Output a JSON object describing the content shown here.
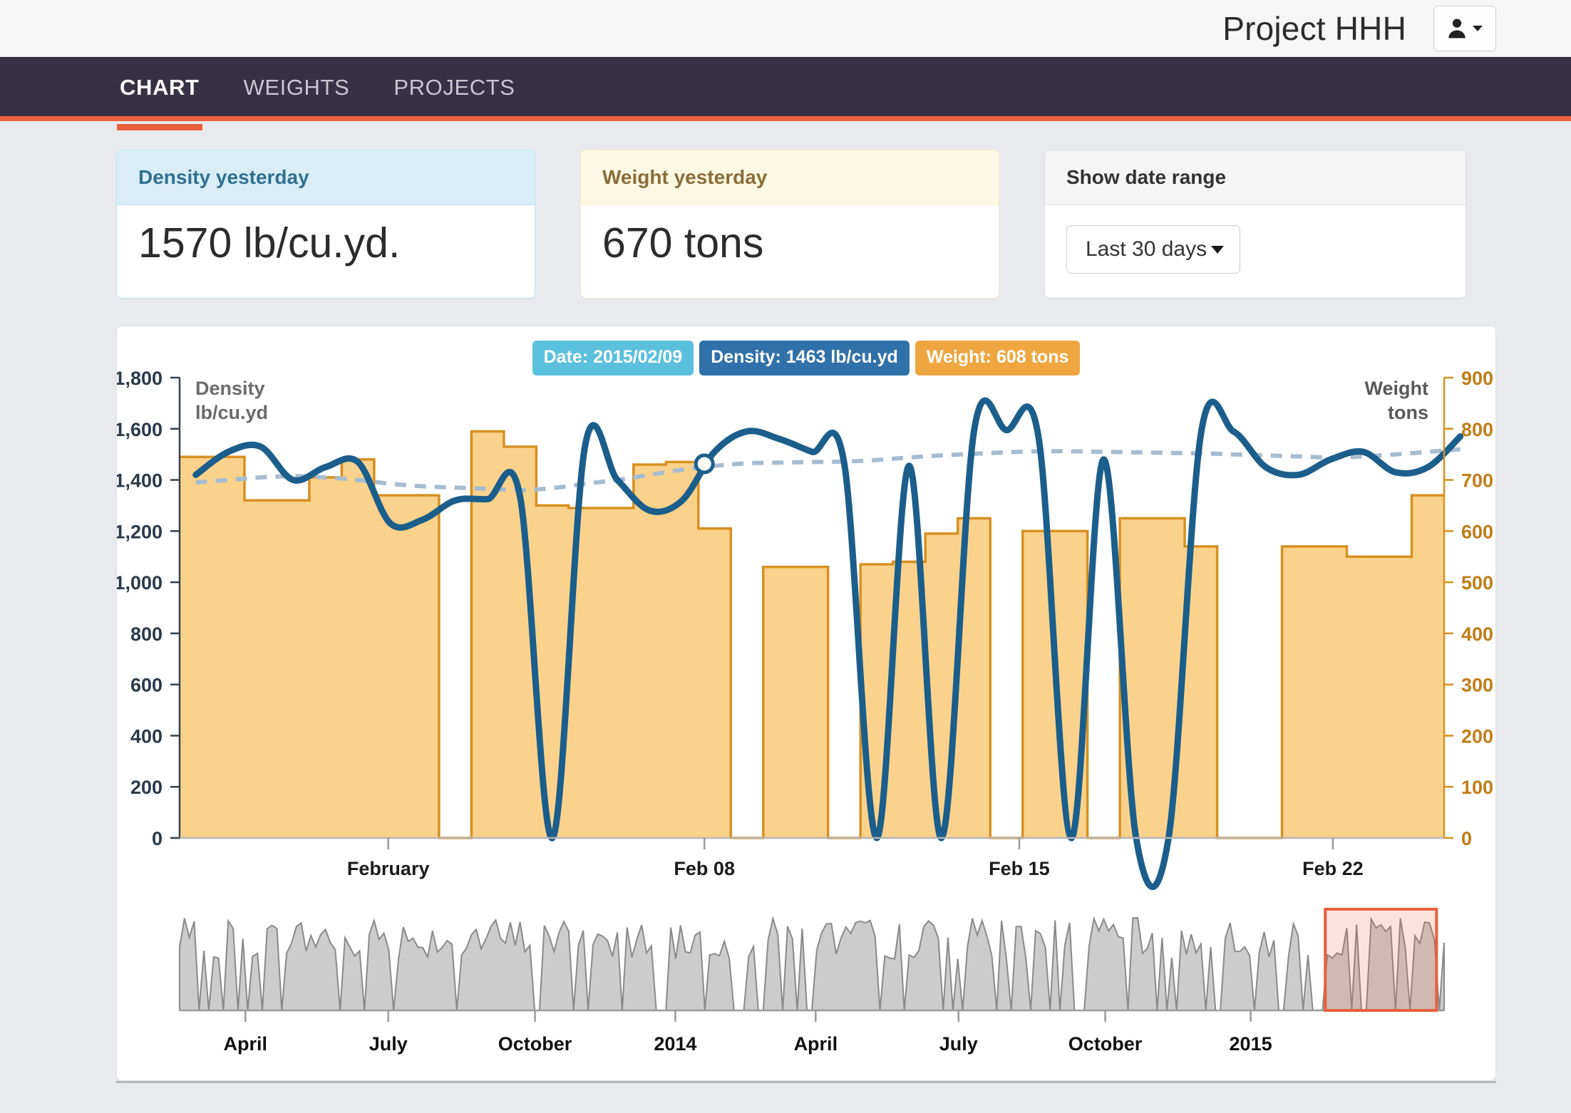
{
  "header": {
    "project_title": "Project HHH",
    "user_menu_icon": "user-icon",
    "user_menu_caret": "caret-down-icon"
  },
  "nav": {
    "tabs": [
      {
        "label": "CHART",
        "active": true
      },
      {
        "label": "WEIGHTS",
        "active": false
      },
      {
        "label": "PROJECTS",
        "active": false
      }
    ],
    "accent_color": "#e8603c",
    "background_color": "#363143"
  },
  "cards": {
    "density": {
      "title": "Density yesterday",
      "value": "1570 lb/cu.yd.",
      "header_bg": "#d9edf7",
      "header_text": "#31708f"
    },
    "weight": {
      "title": "Weight yesterday",
      "value": "670 tons",
      "header_bg": "#fcf8e3",
      "header_text": "#8a6d3b"
    },
    "date_range": {
      "title": "Show date range",
      "selected": "Last 30 days",
      "options": [
        "Last 30 days"
      ]
    }
  },
  "tooltip": {
    "date": "Date: 2015/02/09",
    "density": "Density: 1463 lb/cu.yd",
    "weight": "Weight: 608 tons"
  },
  "chart_data": {
    "type": "line",
    "title": "",
    "xlabel": "",
    "ylabel": "Density lb/cu.yd",
    "y2label": "Weight tons",
    "y_axis_title_lines": [
      "Density",
      "lb/cu.yd"
    ],
    "y2_axis_title_lines": [
      "Weight",
      "tons"
    ],
    "ylim": [
      0,
      1800
    ],
    "y2lim": [
      0,
      900
    ],
    "yticks": [
      0,
      200,
      400,
      600,
      800,
      1000,
      1200,
      1400,
      1600,
      1800
    ],
    "ytick_labels": [
      "0",
      "200",
      "400",
      "600",
      "800",
      "1,000",
      "1,200",
      "1,400",
      "1,600",
      "1,800"
    ],
    "y2ticks": [
      0,
      100,
      200,
      300,
      400,
      500,
      600,
      700,
      800,
      900
    ],
    "y2tick_labels": [
      "0",
      "100",
      "200",
      "300",
      "400",
      "500",
      "600",
      "700",
      "800",
      "900"
    ],
    "grid": false,
    "legend": "none",
    "x_tick_labels": [
      "February",
      "Feb 08",
      "Feb 15",
      "Feb 22"
    ],
    "x_tick_positions": [
      0.165,
      0.415,
      0.664,
      0.912
    ],
    "x_range": [
      "2015/01/27",
      "2015/02/25"
    ],
    "colors": {
      "weight_area_fill": "#fbd28b",
      "weight_area_line": "#d79022",
      "density_line": "#1b5e8c",
      "trend_line": "#a7bcd0",
      "navigator_fill": "#cccccc",
      "navigator_line": "#8a8a8a",
      "navigator_selection": "#e8603c"
    },
    "series": [
      {
        "name": "Weight",
        "type": "area-step",
        "axis": "right",
        "unit": "tons",
        "values": [
          745,
          745,
          660,
          660,
          705,
          740,
          670,
          670,
          0,
          795,
          765,
          650,
          645,
          645,
          730,
          735,
          605,
          0,
          530,
          530,
          0,
          535,
          540,
          595,
          625,
          0,
          600,
          600,
          0,
          625,
          625,
          570,
          0,
          0,
          570,
          570,
          550,
          550,
          670
        ]
      },
      {
        "name": "Density",
        "type": "spline",
        "axis": "left",
        "unit": "lb/cu.yd",
        "values": [
          1420,
          1510,
          1530,
          1400,
          1450,
          1470,
          1230,
          1245,
          1320,
          1325,
          1335,
          0,
          1530,
          1400,
          1280,
          1320,
          1510,
          1590,
          1560,
          1510,
          1463,
          0,
          1455,
          0,
          1590,
          1595,
          1560,
          0,
          1480,
          0,
          0,
          1580,
          1590,
          1450,
          1420,
          1480,
          1510,
          1430,
          1450,
          1570
        ]
      },
      {
        "name": "Trend",
        "type": "spline-dashed",
        "axis": "left",
        "values": [
          1390,
          1400,
          1410,
          1415,
          1410,
          1400,
          1385,
          1375,
          1370,
          1365,
          1360,
          1368,
          1385,
          1400,
          1420,
          1440,
          1455,
          1465,
          1468,
          1470,
          1472,
          1478,
          1488,
          1496,
          1502,
          1508,
          1512,
          1512,
          1510,
          1508,
          1506,
          1504,
          1500,
          1496,
          1492,
          1488,
          1492,
          1500,
          1510,
          1520
        ]
      }
    ],
    "hover_marker": {
      "x_fraction": 0.415,
      "value": 1463,
      "label": "2015/02/09"
    }
  },
  "navigator": {
    "x_tick_labels": [
      "April",
      "July",
      "October",
      "2014",
      "April",
      "July",
      "October",
      "2015"
    ],
    "x_tick_positions": [
      0.052,
      0.165,
      0.281,
      0.392,
      0.503,
      0.616,
      0.732,
      0.847
    ],
    "selection": {
      "start_fraction": 0.906,
      "end_fraction": 0.994
    },
    "series_name": "Weight history"
  }
}
